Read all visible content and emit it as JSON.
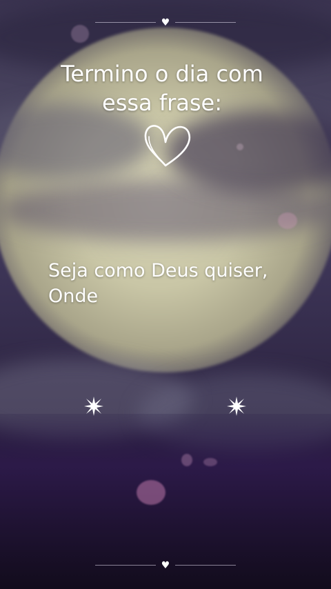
{
  "title": {
    "line1": "Termino o dia com",
    "line2": "essa frase:"
  },
  "quote": {
    "line1": "Seja como Deus quiser,",
    "line2": "Onde"
  },
  "decorations": {
    "divider_icon": "heart-icon",
    "doodle_icon": "hand-drawn-heart-icon",
    "sparkle_icon": "sparkle-icon",
    "divider_glyph": "♥"
  },
  "colors": {
    "text": "#ffffff",
    "sky_top": "#3a3350",
    "sky_bottom": "#1a1228",
    "moon": "#d9d6b8"
  }
}
